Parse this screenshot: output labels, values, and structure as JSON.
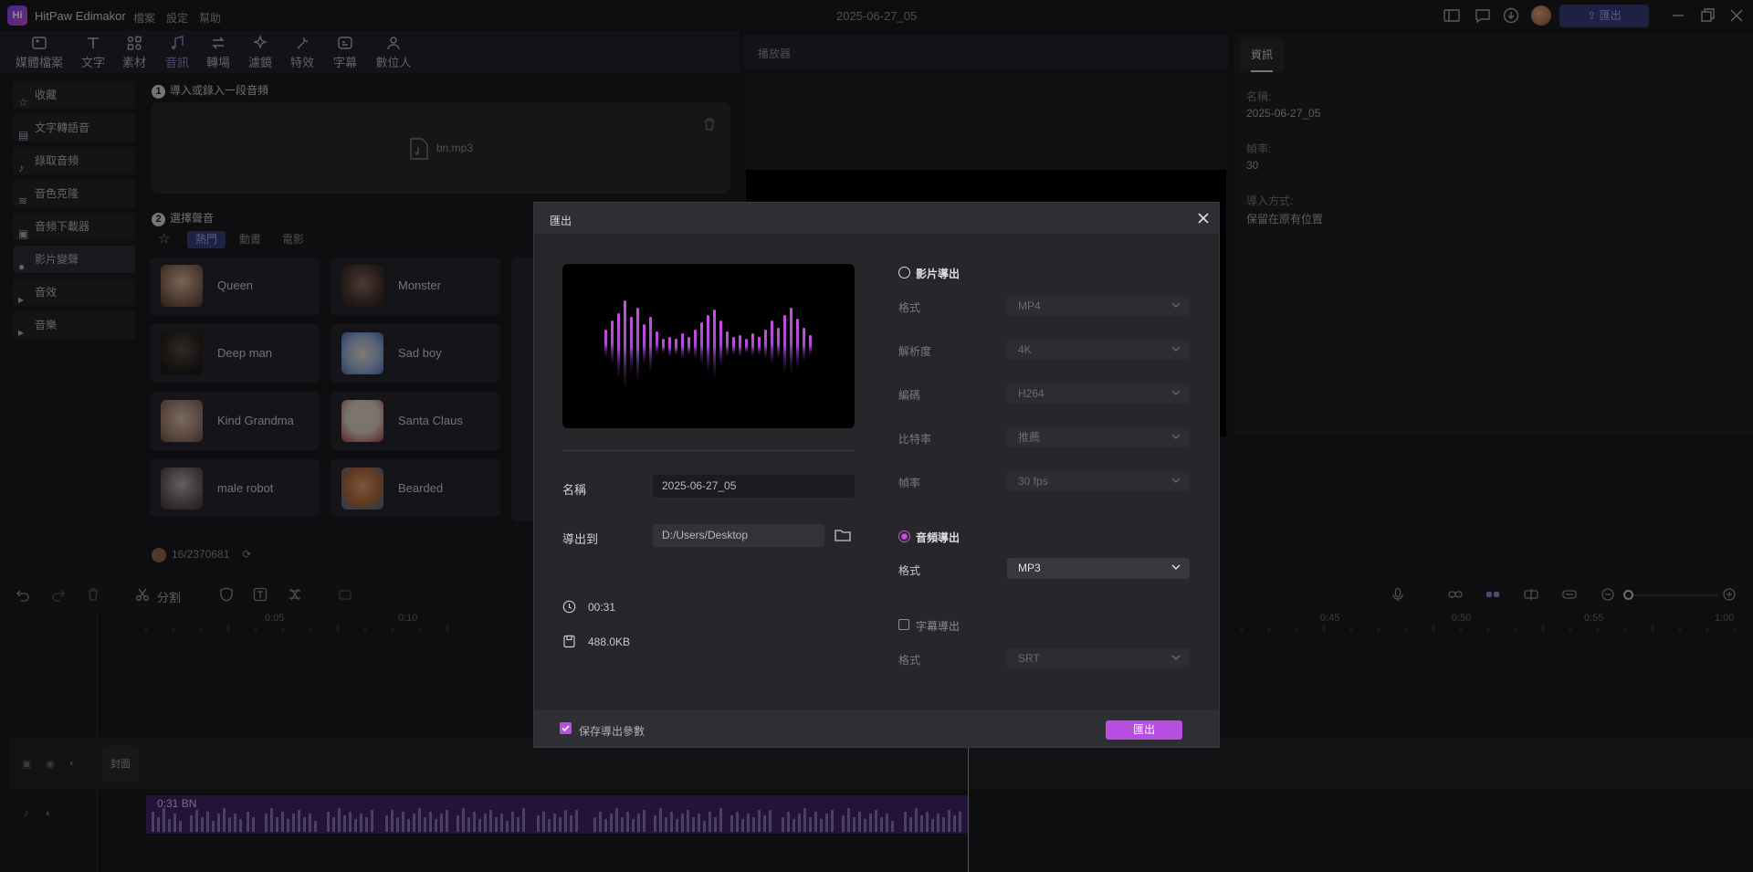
{
  "app": {
    "logo_text": "Hi",
    "name": "HitPaw Edimakor",
    "menus": [
      "檔案",
      "設定",
      "幫助"
    ],
    "doc_title": "2025-06-27_05",
    "export_label": "匯出"
  },
  "toolbar": [
    "媒體檔案",
    "文字",
    "素材",
    "音訊",
    "轉場",
    "濾鏡",
    "特效",
    "字幕",
    "數位人"
  ],
  "sidebar": [
    "收藏",
    "文字轉語音",
    "錄取音頻",
    "音色克隆",
    "音頻下載器",
    "影片變聲",
    "音效",
    "音樂"
  ],
  "voice_panel": {
    "step1_num": "1",
    "step1": "導入或錄入一段音頻",
    "file_name": "bn.mp3",
    "step2_num": "2",
    "step2": "選擇聲音",
    "filters": [
      "熱門",
      "動畫",
      "電影"
    ],
    "voices": [
      "Queen",
      "Monster",
      "Deep man",
      "Sad boy",
      "Kind Grandma",
      "Santa Claus",
      "male robot",
      "Bearded"
    ],
    "counter": "16/2370681"
  },
  "player": {
    "label": "播放器"
  },
  "info": {
    "tab": "資訊",
    "name_label": "名稱:",
    "name_value": "2025-06-27_05",
    "fps_label": "幀率:",
    "fps_value": "30",
    "import_label": "導入方式:",
    "import_value": "保留在原有位置"
  },
  "timeline": {
    "split_label": "分割",
    "ruler": [
      "0:05",
      "0:10",
      "0:45",
      "0:50",
      "0:55",
      "1:00"
    ],
    "cover_label": "封面",
    "clip_label": "0:31  BN"
  },
  "modal": {
    "title": "匯出",
    "name_label": "名稱",
    "name_value": "2025-06-27_05",
    "dest_label": "導出到",
    "dest_value": "D:/Users/Desktop",
    "duration": "00:31",
    "size": "488.0KB",
    "video_export": "影片導出",
    "video_rows": [
      {
        "label": "格式",
        "value": "MP4"
      },
      {
        "label": "解析度",
        "value": "4K"
      },
      {
        "label": "編碼",
        "value": "H264"
      },
      {
        "label": "比特率",
        "value": "推薦"
      },
      {
        "label": "幀率",
        "value": "30  fps"
      }
    ],
    "audio_export": "音頻導出",
    "audio_format_label": "格式",
    "audio_format_value": "MP3",
    "subtitle_export": "字幕導出",
    "subtitle_format_label": "格式",
    "subtitle_format_value": "SRT",
    "save_params": "保存導出參數",
    "export_button": "匯出",
    "accent": "#b64fe0"
  }
}
